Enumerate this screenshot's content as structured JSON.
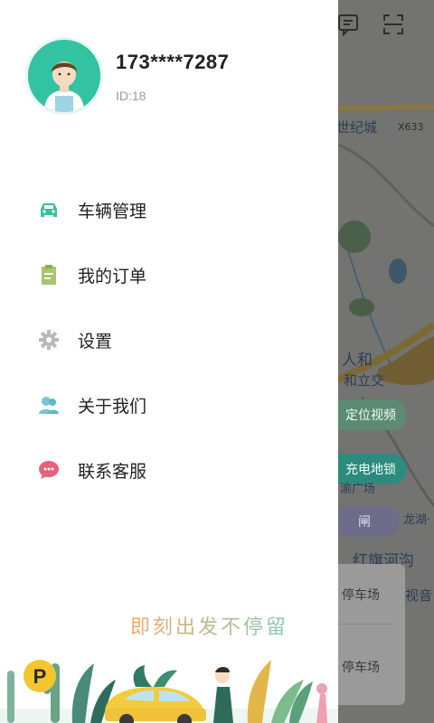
{
  "profile": {
    "phone": "173****7287",
    "user_id": "ID:18"
  },
  "menu": [
    {
      "label": "车辆管理",
      "icon": "car-icon",
      "color": "#3bbf9f"
    },
    {
      "label": "我的订单",
      "icon": "clipboard-icon",
      "color": "#a8c470"
    },
    {
      "label": "设置",
      "icon": "gear-icon",
      "color": "#b9b9b9"
    },
    {
      "label": "关于我们",
      "icon": "users-icon",
      "color": "#5fb7c9"
    },
    {
      "label": "联系客服",
      "icon": "chat-icon",
      "color": "#e8617a"
    }
  ],
  "slogan": "即刻出发不停留",
  "badge_letter": "P",
  "map": {
    "labels": [
      "世纪城",
      "X633",
      "人和",
      "和立交",
      "龙湖·",
      "红旗河沟",
      "视音"
    ],
    "buttons": [
      "定位视频",
      "充电地锁"
    ],
    "sub_labels": [
      "渝广场",
      "闸"
    ],
    "card_items": [
      "停车场",
      "停车场"
    ]
  },
  "colors": {
    "accent": "#33c3a2",
    "drawer_bg": "#ffffff"
  }
}
